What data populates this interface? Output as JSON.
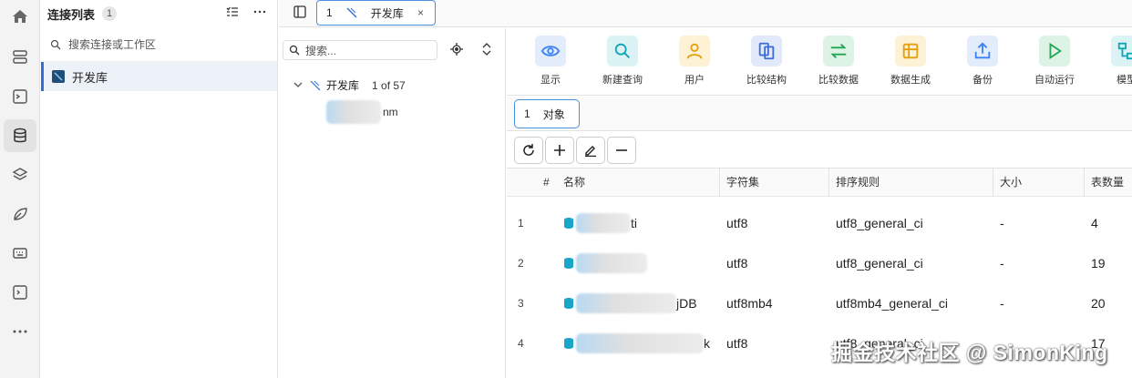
{
  "sidebar": {
    "icons": [
      "home-icon",
      "connections-icon",
      "terminal-icon",
      "database-icon",
      "layers-icon",
      "leaf-icon",
      "keyboard-icon",
      "console-icon",
      "more-icon"
    ]
  },
  "connections": {
    "title": "连接列表",
    "count": "1",
    "search_placeholder": "搜索连接或工作区",
    "items": [
      {
        "label": "开发库"
      }
    ]
  },
  "tabs": [
    {
      "num": "1",
      "label": "开发库",
      "close": "×"
    }
  ],
  "tree": {
    "search_placeholder": "搜索...",
    "db_name": "开发库",
    "db_count": "1 of 57",
    "child_suffix": "nm"
  },
  "toolbar": {
    "items": [
      {
        "label": "显示",
        "icon": "eye-icon",
        "color": "#3b82f6",
        "bg": "#e2ecfb"
      },
      {
        "label": "新建查询",
        "icon": "search-icon",
        "color": "#0ea5b7",
        "bg": "#dcf3f6"
      },
      {
        "label": "用户",
        "icon": "user-icon",
        "color": "#e3a008",
        "bg": "#fdf1d6"
      },
      {
        "label": "比较结构",
        "icon": "compare-structure-icon",
        "color": "#3b6fd6",
        "bg": "#e2e9fb"
      },
      {
        "label": "比较数据",
        "icon": "compare-data-icon",
        "color": "#22a559",
        "bg": "#dcf3e5"
      },
      {
        "label": "数据生成",
        "icon": "data-generate-icon",
        "color": "#e3a008",
        "bg": "#fdf1d6"
      },
      {
        "label": "备份",
        "icon": "backup-icon",
        "color": "#3b82f6",
        "bg": "#e2ecfb"
      },
      {
        "label": "自动运行",
        "icon": "play-icon",
        "color": "#22a559",
        "bg": "#dcf3e5"
      },
      {
        "label": "模型",
        "icon": "model-icon",
        "color": "#0ea5b7",
        "bg": "#dcf3f6"
      }
    ]
  },
  "subtabs": [
    {
      "num": "1",
      "label": "对象"
    }
  ],
  "table": {
    "columns": [
      "#",
      "名称",
      "字符集",
      "排序规则",
      "大小",
      "表数量"
    ],
    "rows": [
      {
        "idx": "1",
        "name_suffix": "ti",
        "charset": "utf8",
        "collation": "utf8_general_ci",
        "size": "-",
        "tables": "4"
      },
      {
        "idx": "2",
        "name_suffix": "",
        "charset": "utf8",
        "collation": "utf8_general_ci",
        "size": "-",
        "tables": "19"
      },
      {
        "idx": "3",
        "name_suffix": "jDB",
        "charset": "utf8mb4",
        "collation": "utf8mb4_general_ci",
        "size": "-",
        "tables": "20"
      },
      {
        "idx": "4",
        "name_suffix": "k",
        "charset": "utf8",
        "collation": "utf8_general_ci",
        "size": "",
        "tables": "17"
      }
    ]
  },
  "watermark": "掘金技术社区 @ SimonKing"
}
